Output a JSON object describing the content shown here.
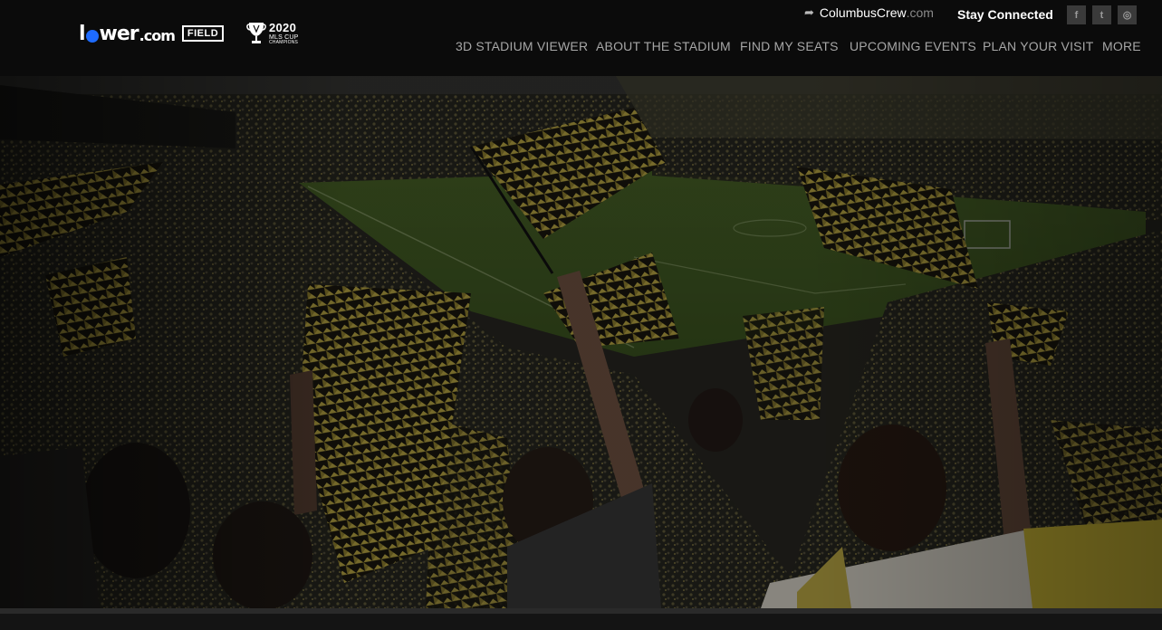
{
  "header": {
    "logo": {
      "name": "l",
      "name_end": "wer",
      "tld": ".com",
      "badge": "FIELD"
    },
    "cup": {
      "year": "2020",
      "line1": "MLS CUP",
      "line2": "CHAMPIONS"
    },
    "crew_link": {
      "brand": "ColumbusCrew",
      "domain": ".com"
    },
    "stay_connected": "Stay Connected",
    "social": [
      {
        "icon": "facebook-icon",
        "glyph": "f"
      },
      {
        "icon": "twitter-icon",
        "glyph": "t"
      },
      {
        "icon": "instagram-icon",
        "glyph": "◎"
      }
    ],
    "nav": [
      "3D STADIUM VIEWER",
      "ABOUT THE STADIUM",
      "FIND MY SEATS",
      "UPCOMING EVENTS",
      "PLAN YOUR VISIT",
      "MORE"
    ]
  },
  "colors": {
    "header_bg": "#0b0b0b",
    "accent_blue": "#1e6bff",
    "crew_yellow": "#d8c44a",
    "nav_text": "#a6a6a6"
  }
}
